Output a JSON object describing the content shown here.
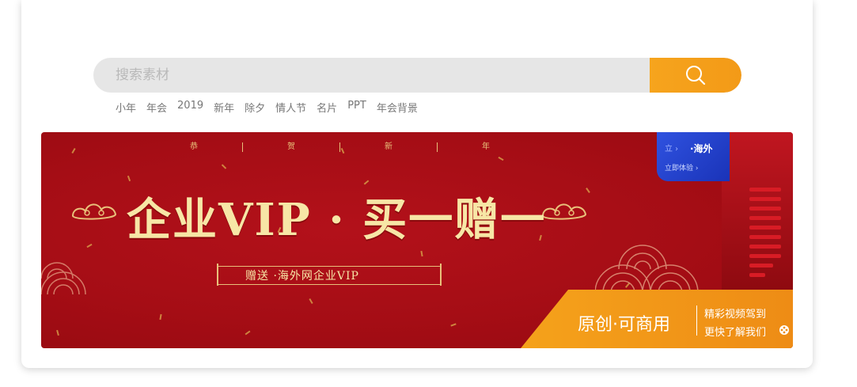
{
  "search": {
    "placeholder": "搜索素材",
    "button_icon": "search-icon"
  },
  "tags": [
    "小年",
    "年会",
    "2019",
    "新年",
    "除夕",
    "情人节",
    "名片",
    "PPT",
    "年会背景"
  ],
  "banner": {
    "greeting": [
      "恭",
      "贺",
      "新",
      "年"
    ],
    "headline": "企业VIP · 买一赠一",
    "subtitle": "赠送    ·海外网企业VIP",
    "badge": {
      "title": "·海外",
      "subtitle": "立即体验 ›"
    },
    "promo": {
      "main": "原创·可商用",
      "line1": "精彩视频驾到",
      "line2": "更快了解我们"
    },
    "colors": {
      "background": "#a50d15",
      "gold": "#f7e6a6",
      "orange": "#f5a21b",
      "blue": "#2f52e0"
    }
  }
}
